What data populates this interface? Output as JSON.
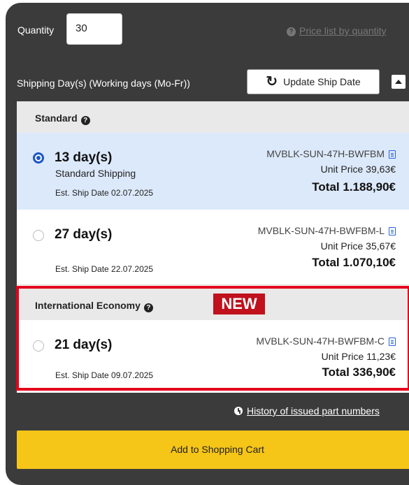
{
  "quantity": {
    "label": "Quantity",
    "value": "30"
  },
  "price_list_link": "Price list by quantity",
  "shipping": {
    "label": "Shipping Day(s) (Working days (Mo-Fr))",
    "update_button": "Update Ship Date"
  },
  "sections": {
    "standard": {
      "title": "Standard"
    },
    "international": {
      "title": "International Economy",
      "badge": "NEW"
    }
  },
  "options": [
    {
      "days": "13 day(s)",
      "method": "Standard Shipping",
      "est": "Est. Ship Date 02.07.2025",
      "part": "MVBLK-SUN-47H-BWFBM",
      "unit_price": "Unit Price 39,63€",
      "total": "Total 1.188,90€",
      "selected": true
    },
    {
      "days": "27 day(s)",
      "est": "Est. Ship Date 22.07.2025",
      "part": "MVBLK-SUN-47H-BWFBM-L",
      "unit_price": "Unit Price 35,67€",
      "total": "Total 1.070,10€",
      "selected": false
    },
    {
      "days": "21 day(s)",
      "est": "Est. Ship Date 09.07.2025",
      "part": "MVBLK-SUN-47H-BWFBM-C",
      "unit_price": "Unit Price 11,23€",
      "total": "Total 336,90€",
      "selected": false
    }
  ],
  "history_link": "History of issued part numbers",
  "cart_button": "Add to Shopping Cart",
  "colors": {
    "panel": "#3b3b3b",
    "selected_row": "#dce9fb",
    "highlight_border": "#e4001b",
    "new_badge": "#c0111d",
    "cart_button": "#f5c518",
    "link_blue": "#2c64d8"
  },
  "icons": {
    "help": "question-circle-icon",
    "refresh": "refresh-icon",
    "collapse": "chevron-up-icon",
    "document": "document-icon",
    "history": "clock-icon"
  }
}
